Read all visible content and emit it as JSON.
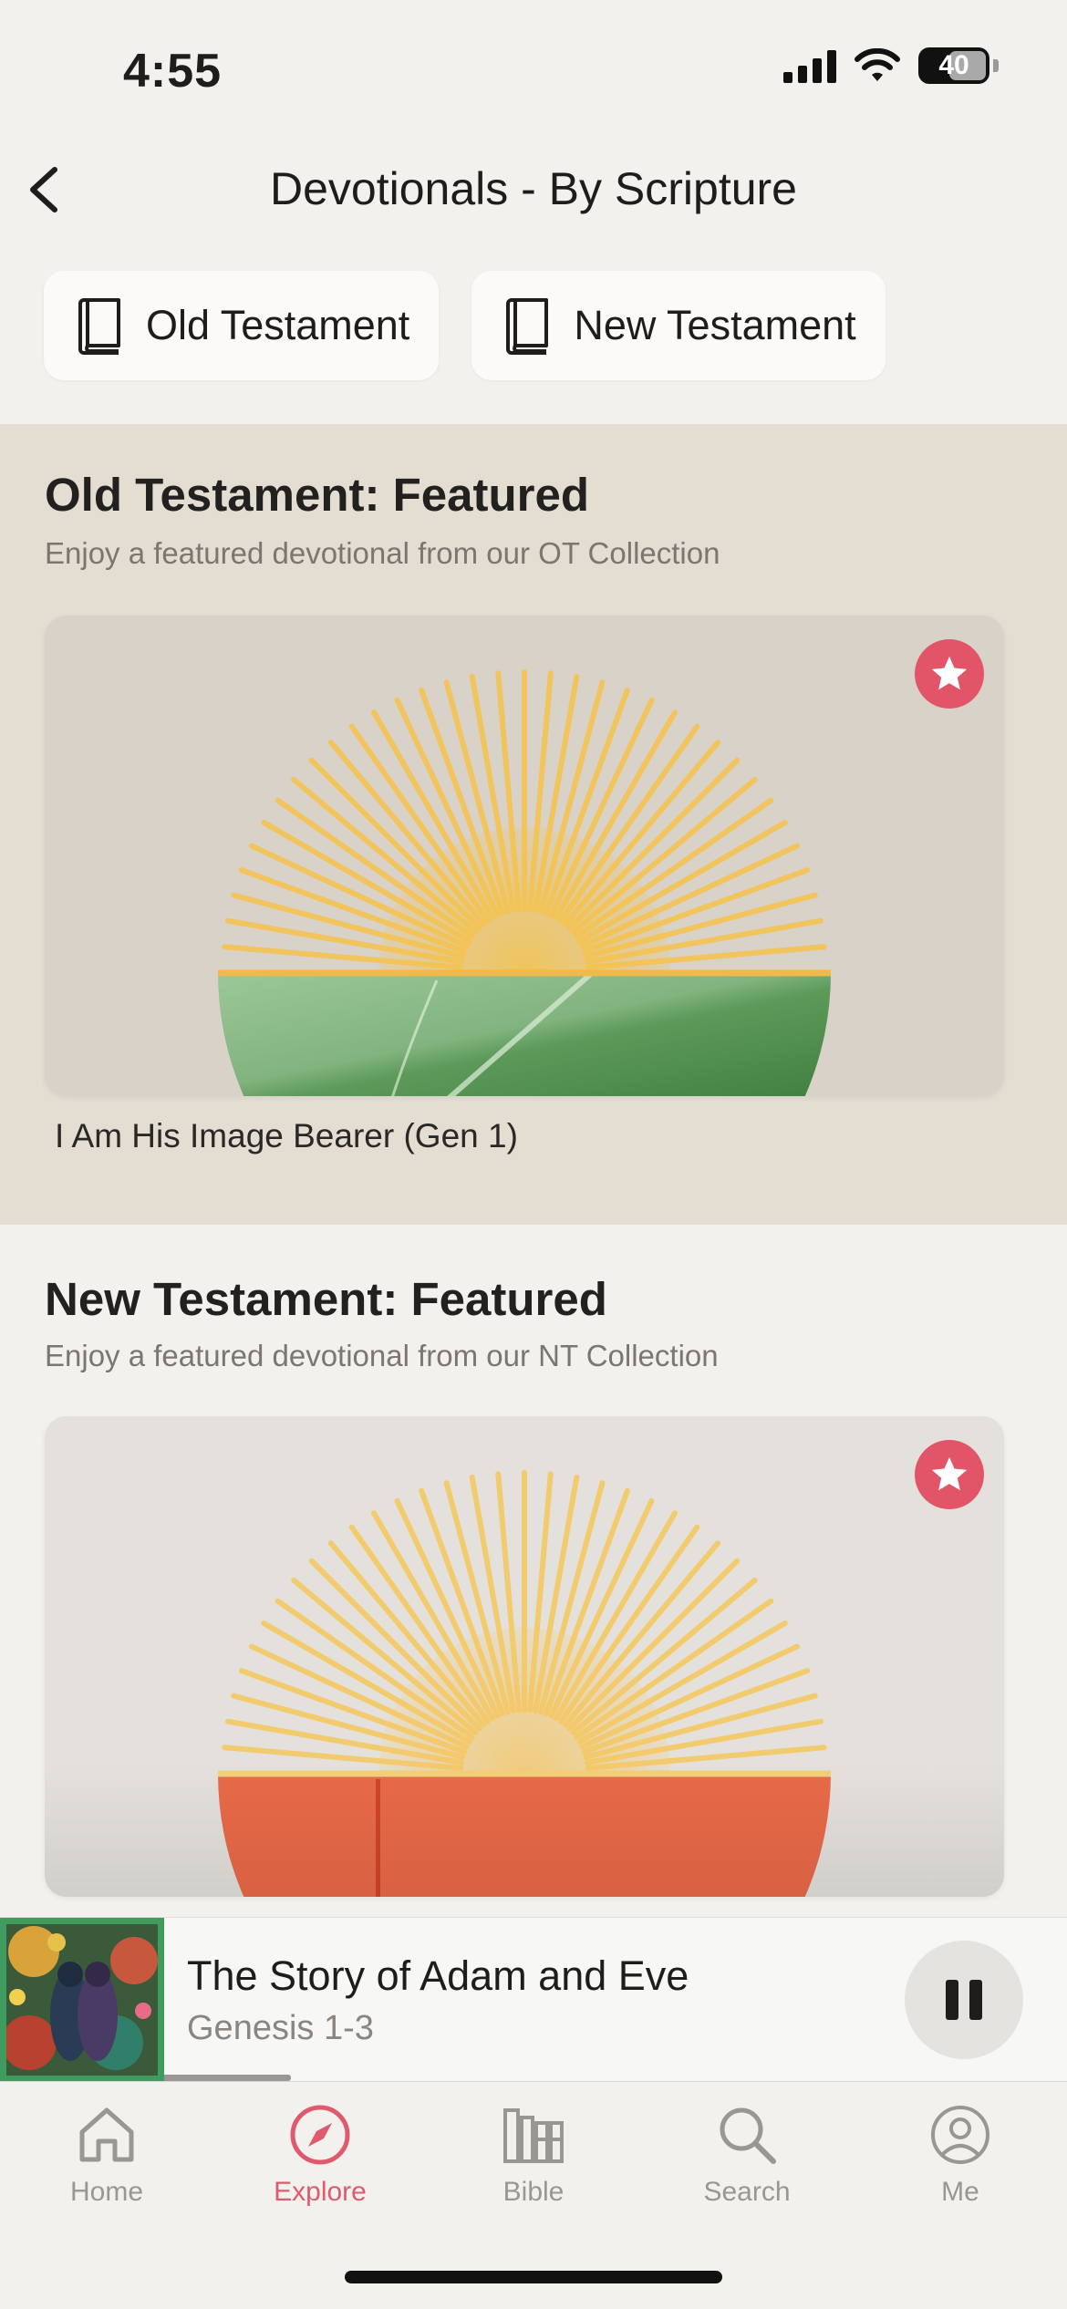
{
  "status_bar": {
    "time": "4:55",
    "battery": "40"
  },
  "header": {
    "title": "Devotionals - By Scripture"
  },
  "chips": [
    {
      "label": "Old Testament",
      "icon": "book-icon"
    },
    {
      "label": "New Testament",
      "icon": "book-icon"
    }
  ],
  "sections": {
    "ot": {
      "title": "Old Testament: Featured",
      "subtitle": "Enjoy a featured devotional from our OT Collection",
      "card_caption": "I Am His Image Bearer (Gen 1)"
    },
    "nt": {
      "title": "New Testament: Featured",
      "subtitle": "Enjoy a featured devotional from our NT Collection"
    }
  },
  "mini_player": {
    "title": "The Story of Adam and Eve",
    "subtitle": "Genesis 1-3",
    "progress": 0.14
  },
  "tabs": [
    {
      "label": "Home",
      "icon": "home-icon",
      "active": false
    },
    {
      "label": "Explore",
      "icon": "compass-icon",
      "active": true
    },
    {
      "label": "Bible",
      "icon": "bible-books-icon",
      "active": false
    },
    {
      "label": "Search",
      "icon": "search-icon",
      "active": false
    },
    {
      "label": "Me",
      "icon": "profile-icon",
      "active": false
    }
  ],
  "colors": {
    "accent": "#e05a6e",
    "badge": "#e25568",
    "ot_section_bg": "#e3ddd2",
    "sun_rays": "#f2c45e",
    "ot_ground": "#6aa66a",
    "nt_ground": "#e96a48"
  }
}
